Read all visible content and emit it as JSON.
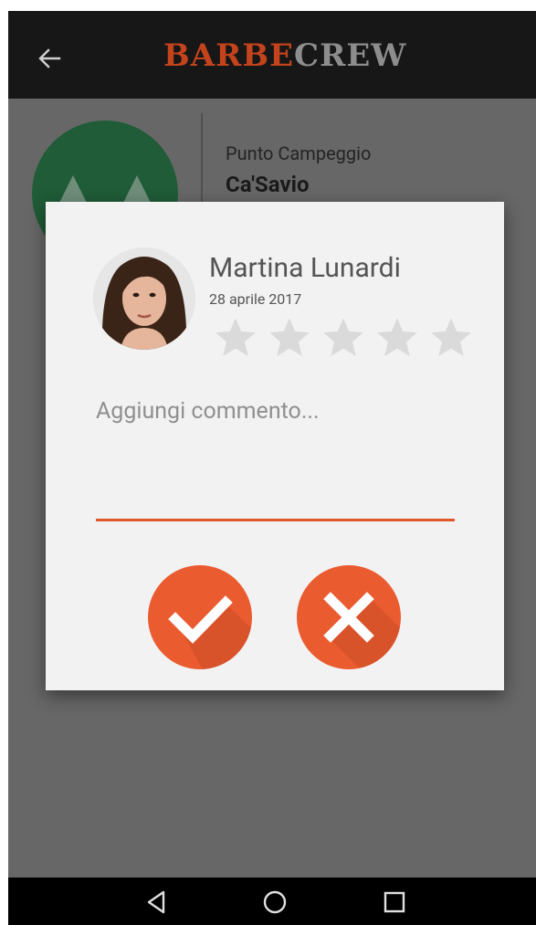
{
  "app": {
    "brand_part1": "BARBE",
    "brand_part2": "CREW",
    "brand_color_primary": "#c2431c",
    "brand_color_secondary": "#8d8d8d",
    "back_icon": "arrow-left-icon"
  },
  "background": {
    "label": "Punto Campeggio",
    "name": "Ca'Savio"
  },
  "dialog": {
    "user_name": "Martina Lunardi",
    "date": "28 aprile 2017",
    "rating": 0,
    "max_rating": 5,
    "comment_placeholder": "Aggiungi commento...",
    "comment_value": "",
    "confirm_icon": "checkmark-icon",
    "cancel_icon": "close-icon",
    "accent_color": "#ea5b30"
  },
  "navbar": {
    "back_icon": "triangle-back-icon",
    "home_icon": "circle-home-icon",
    "recents_icon": "square-recents-icon"
  }
}
